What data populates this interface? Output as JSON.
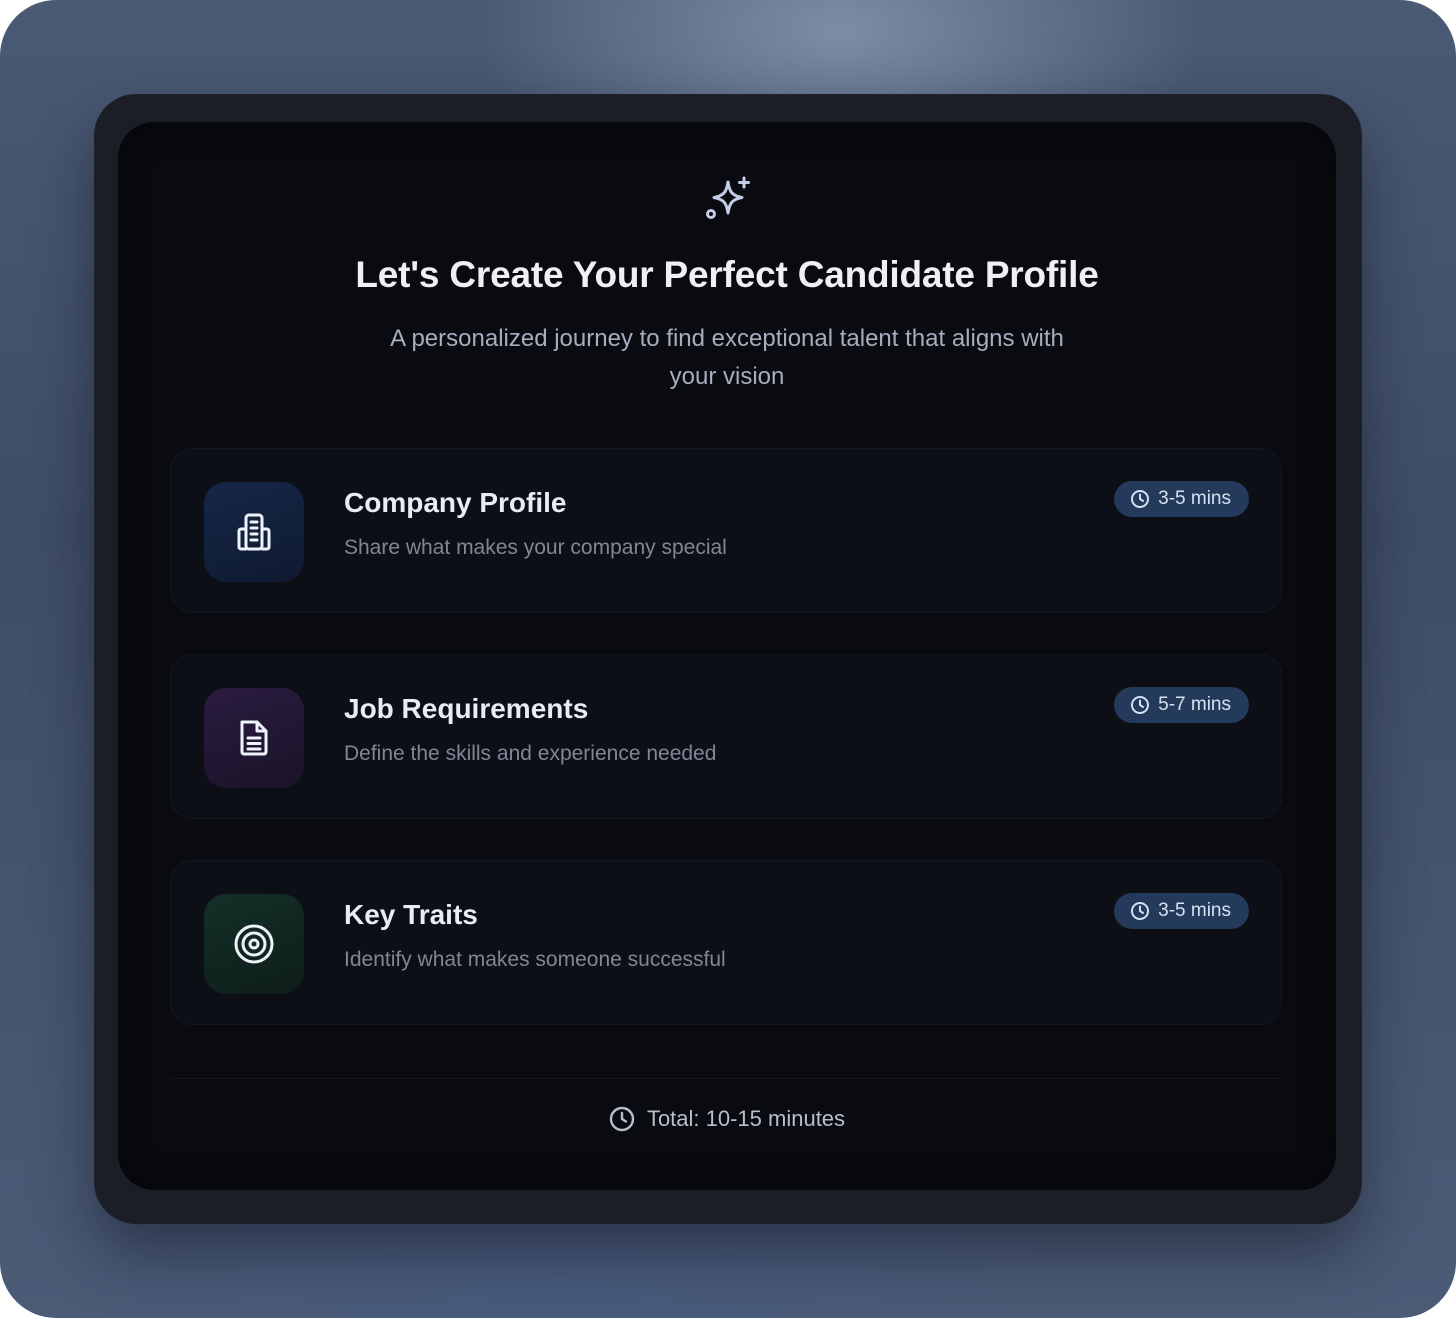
{
  "header": {
    "icon": "sparkles-icon",
    "title": "Let's Create Your Perfect Candidate Profile",
    "subtitle": "A personalized journey to find exceptional talent that aligns with your vision"
  },
  "steps": [
    {
      "title": "Company Profile",
      "description": "Share what makes your company special",
      "duration": "3-5 mins",
      "icon": "building-icon",
      "icon_color": "#12213d"
    },
    {
      "title": "Job Requirements",
      "description": "Define the skills and experience needed",
      "duration": "5-7 mins",
      "icon": "document-icon",
      "icon_color": "#241a36"
    },
    {
      "title": "Key Traits",
      "description": "Identify what makes someone successful",
      "duration": "3-5 mins",
      "icon": "target-icon",
      "icon_color": "#112a24"
    }
  ],
  "footer": {
    "total": "Total: 10-15 minutes",
    "icon": "clock-icon"
  },
  "colors": {
    "badge_bg": "#243a5a",
    "panel_bg": "#090b10",
    "card_bg": "#0d0f17"
  }
}
